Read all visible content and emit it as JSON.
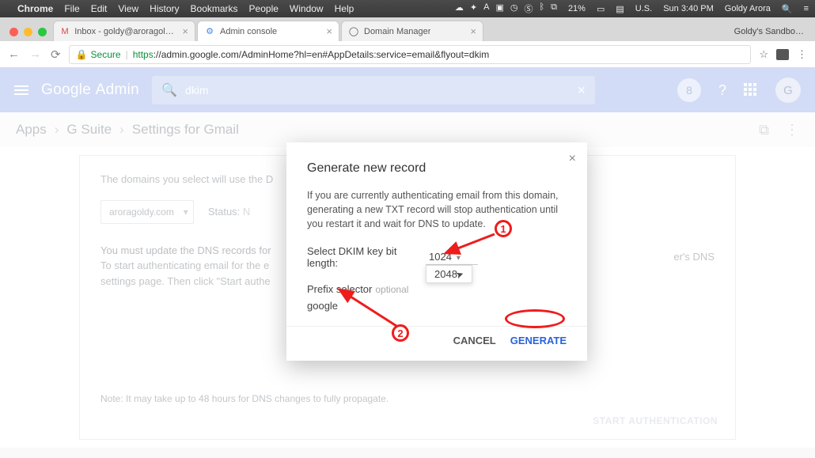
{
  "mac_menu": {
    "app": "Chrome",
    "items": [
      "File",
      "Edit",
      "View",
      "History",
      "Bookmarks",
      "People",
      "Window",
      "Help"
    ],
    "right": {
      "battery": "21%",
      "flag": "U.S.",
      "day_time": "Sun 3:40 PM",
      "user": "Goldy Arora"
    }
  },
  "tabs": [
    {
      "favicon": "M",
      "title": "Inbox - goldy@aroragoldy.com"
    },
    {
      "favicon": "⚙",
      "title": "Admin console"
    },
    {
      "favicon": "◯",
      "title": "Domain Manager"
    }
  ],
  "bookmark_toolbar_item": "Goldy's Sandbo…",
  "address": {
    "secure_label": "Secure",
    "url_display": "https://admin.google.com/AdminHome?hl=en#AppDetails:service=email&flyout=dkim"
  },
  "ga_header": {
    "logo_left": "Google",
    "logo_right": "Admin",
    "search_value": "dkim",
    "avatar_letter": "G"
  },
  "breadcrumb": [
    "Apps",
    "G Suite",
    "Settings for Gmail"
  ],
  "page": {
    "intro": "The domains you select will use the D",
    "domain": "aroragoldy.com",
    "status_label": "Status:",
    "dns_line": "You must update the DNS records for",
    "dns_sub1": "To start authenticating email for the e",
    "dns_sub2": "settings page. Then click \"Start authe",
    "dns_tail": "er's DNS",
    "note": "Note: It may take up to 48 hours for DNS changes to fully propagate.",
    "start_auth": "START AUTHENTICATION"
  },
  "modal": {
    "title": "Generate new record",
    "body": "If you are currently authenticating email from this domain, generating a new TXT record will stop authentication until you restart it and wait for DNS to update.",
    "bit_label": "Select DKIM key bit length:",
    "bit_value": "1024",
    "bit_option": "2048",
    "prefix_label": "Prefix selector",
    "prefix_optional": "optional",
    "prefix_value": "google",
    "cancel": "CANCEL",
    "generate": "GENERATE"
  },
  "annotations": {
    "one": "1",
    "two": "2"
  }
}
